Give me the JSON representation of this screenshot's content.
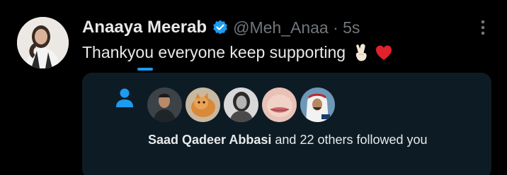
{
  "tweet": {
    "author_name": "Anaaya Meerab",
    "handle_and_time": "@Meh_Anaa · 5s",
    "text": "Thankyou everyone keep supporting"
  },
  "notification_card": {
    "bold_name": "Saad Qadeer Abbasi",
    "rest_text": " and 22 others followed you"
  },
  "colors": {
    "accent": "#1d9bf0",
    "card_bg": "#0d1b24",
    "muted": "#71767b",
    "text": "#e7e9ea"
  }
}
